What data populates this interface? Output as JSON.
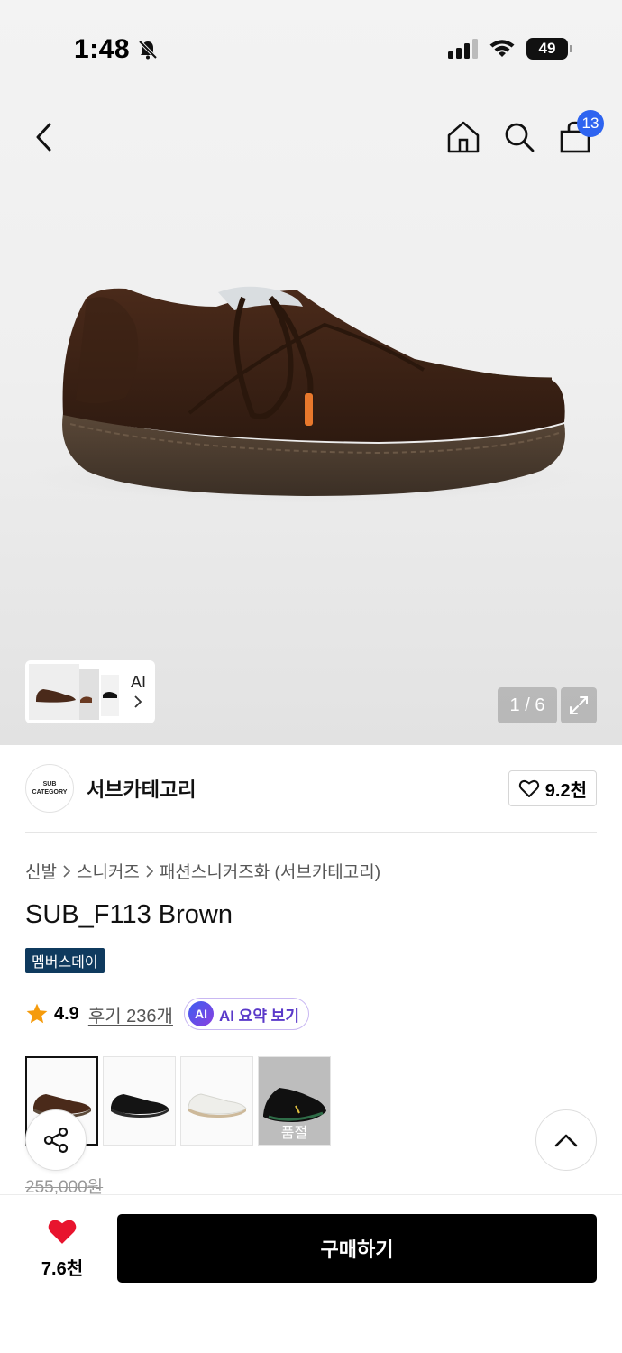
{
  "status_bar": {
    "time": "1:48",
    "battery": "49"
  },
  "nav": {
    "cart_count": "13"
  },
  "gallery": {
    "ai_label": "AI",
    "page_indicator": "1 / 6"
  },
  "brand": {
    "logo_text_top": "SUB",
    "logo_text_bottom": "CATEGORY",
    "name": "서브카테고리",
    "like_count": "9.2천"
  },
  "breadcrumb": [
    "신발",
    "스니커즈",
    "패션스니커즈화 (서브카테고리)"
  ],
  "product": {
    "title": "SUB_F113 Brown",
    "tag": "멤버스데이",
    "rating": "4.9",
    "reviews": "후기 236개",
    "ai_summary": "AI 요약 보기",
    "ai_badge": "AI",
    "original_price": "255,000원"
  },
  "options": [
    {
      "color": "brown",
      "selected": true,
      "soldout": false
    },
    {
      "color": "black",
      "selected": false,
      "soldout": false
    },
    {
      "color": "white",
      "selected": false,
      "soldout": false
    },
    {
      "color": "black-green",
      "selected": false,
      "soldout": true,
      "soldout_label": "품절"
    }
  ],
  "bottom": {
    "like_count": "7.6천",
    "buy_label": "구매하기"
  },
  "colors": {
    "accent_blue": "#2e64f0",
    "tag_navy": "#0f3a5e",
    "heart_red": "#e8142e",
    "star": "#f59b0c"
  }
}
